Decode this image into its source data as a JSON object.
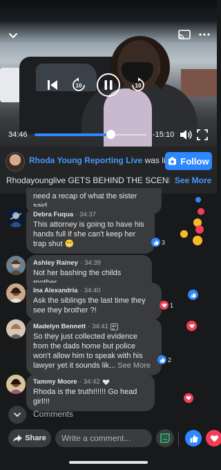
{
  "player": {
    "elapsed": "34:46",
    "remaining": "-15:10",
    "progress_fraction": 0.68
  },
  "header": {
    "page_name": "Rhoda Young Reporting Live",
    "status": "was live",
    "follow_label": "Follow",
    "description": "Rhodayounglive GETS BEHIND THE SCENES...",
    "see_more": "See More"
  },
  "comments": [
    {
      "name": "",
      "time": "",
      "text": "need a recap of what the sister said."
    },
    {
      "name": "Debra Fuqua",
      "time": "34:37",
      "text": "This attorney is going to have his hands full if she can't keep her trap shut",
      "reaction_count": "3"
    },
    {
      "name": "Ashley Rainey",
      "time": "34:39",
      "text": "Not her bashing the childs mother"
    },
    {
      "name": "Ina Alexandria",
      "time": "34:40",
      "text": "Ask the siblings the last time they see they brother ?!",
      "reaction_count": "1"
    },
    {
      "name": "Madelyn Bennett",
      "time": "34:41",
      "text": "So they just collected evidence from the dads home but police won't allow him to speak with his lawyer yet it sounds lik...",
      "see_more": "See More",
      "reaction_count": "2"
    },
    {
      "name": "Tammy Moore",
      "time": "34:42",
      "text": "Rhoda is the truth!!!!!! Go head girl!!!"
    }
  ],
  "footer": {
    "comments_label": "Comments",
    "share_label": "Share",
    "comment_placeholder": "Write a comment..."
  },
  "colors": {
    "accent": "#2d88ff",
    "love": "#f33e58",
    "background": "#18191a",
    "bubble": "#3a3b3c"
  }
}
